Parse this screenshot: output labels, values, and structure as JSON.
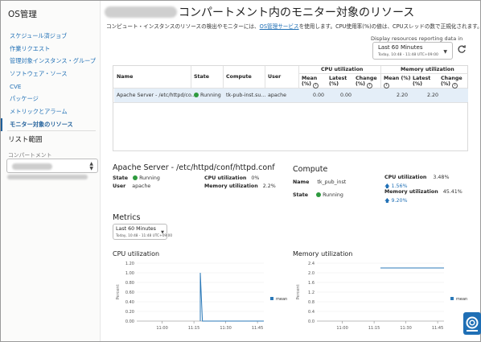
{
  "sidebar": {
    "title": "OS管理",
    "items": [
      {
        "label": "スケジュール済ジョブ"
      },
      {
        "label": "作業リクエスト"
      },
      {
        "label": "管理対象インスタンス・グループ"
      },
      {
        "label": "ソフトウェア・ソース"
      },
      {
        "label": "CVE"
      },
      {
        "label": "パッケージ"
      },
      {
        "label": "メトリックとアラーム"
      },
      {
        "label": "モニター対象のリソース"
      }
    ],
    "scope_title": "リスト範囲",
    "compartment_label": "コンパートメント"
  },
  "header": {
    "title": "コンパートメント内のモニター対象のリソース",
    "description_prefix": "コンピュート・インスタンスのリソースの検出やモニターには、",
    "description_link": "OS管理サービス",
    "description_suffix": "を使用します。CPU使用率(%)の値は、CPUスレッドの数で正規化されます。",
    "range_label": "Display resources reporting data in",
    "range_value": "Last 60 Minutes",
    "range_sub": "Today, 10:48 - 11:48 UTC+09:00"
  },
  "table": {
    "headers": {
      "name": "Name",
      "state": "State",
      "compute": "Compute",
      "user": "User",
      "cpu_group": "CPU utilization",
      "mem_group": "Memory utilization",
      "mean": "Mean",
      "latest": "Latest",
      "change": "Change",
      "pct": "(%)"
    },
    "rows": [
      {
        "name": "Apache Server - /etc/httpd/co...",
        "state": "Running",
        "compute": "tk-pub-inst.su...",
        "user": "apache",
        "cpu_mean": "0.00",
        "cpu_latest": "0.00",
        "cpu_change": "",
        "mem_mean": "2.20",
        "mem_latest": "2.20",
        "mem_change": ""
      }
    ]
  },
  "detail": {
    "title": "Apache Server - /etc/httpd/conf/httpd.conf",
    "state_label": "State",
    "state_value": "Running",
    "user_label": "User",
    "user_value": "apache",
    "cpu_label": "CPU utilization",
    "cpu_value": "0%",
    "mem_label": "Memory utilization",
    "mem_value": "2.2%"
  },
  "compute": {
    "title": "Compute",
    "name_label": "Name",
    "name_value": "tk_pub_inst",
    "state_label": "State",
    "state_value": "Running",
    "cpu_label": "CPU utilization",
    "cpu_value": "3.48%",
    "cpu_change": "1.56%",
    "mem_label": "Memory utilization",
    "mem_value": "45.41%",
    "mem_change": "9.20%"
  },
  "metrics": {
    "title": "Metrics",
    "range_value": "Last 60 Minutes",
    "range_sub": "Today, 10:48 - 11:48 UTC+09:00"
  },
  "chart_data": [
    {
      "type": "line",
      "title": "CPU utilization",
      "ylabel": "Percent",
      "ylim": [
        0,
        1.2
      ],
      "yticks": [
        "0.00",
        "0.20",
        "0.40",
        "0.60",
        "0.80",
        "1.00",
        "1.20"
      ],
      "xticks": [
        "11:00",
        "11:15",
        "11:30",
        "11:45"
      ],
      "series": [
        {
          "name": "mean",
          "x": [
            "11:18",
            "11:18",
            "11:19",
            "11:48"
          ],
          "values": [
            0,
            1.0,
            0,
            0
          ]
        }
      ]
    },
    {
      "type": "line",
      "title": "Memory utilization",
      "ylabel": "Percent",
      "ylim": [
        0,
        2.4
      ],
      "yticks": [
        "0.0",
        "0.4",
        "0.8",
        "1.2",
        "1.6",
        "2.0",
        "2.4"
      ],
      "xticks": [
        "11:00",
        "11:15",
        "11:30",
        "11:45"
      ],
      "series": [
        {
          "name": "mean",
          "x": [
            "11:18",
            "11:48"
          ],
          "values": [
            2.2,
            2.2
          ]
        }
      ]
    }
  ],
  "colors": {
    "accent": "#1f6fb5",
    "running": "#2e9a3e",
    "series": "#2b79b8"
  }
}
